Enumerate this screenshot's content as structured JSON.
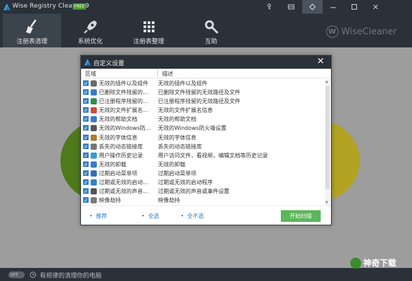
{
  "app": {
    "title": "Wise Registry Cleaner 9",
    "badge": "FREE",
    "brand": "WiseCleaner"
  },
  "nav": [
    {
      "label": "注册表清理",
      "icon": "broom-icon",
      "active": true
    },
    {
      "label": "系统优化",
      "icon": "rocket-icon",
      "active": false
    },
    {
      "label": "注册表整理",
      "icon": "blocks-icon",
      "active": false
    },
    {
      "label": "互助",
      "icon": "tools-icon",
      "active": false
    }
  ],
  "dialog": {
    "title": "自定义设置",
    "col_area": "区域",
    "col_desc": "描述",
    "rows": [
      {
        "name": "无效的插件以及组件",
        "desc": "无效的插件以及组件",
        "icon": "plugin-icon",
        "checked": true
      },
      {
        "name": "已删除文件残留的...",
        "desc": "已删除文件残留的无效路径及文件",
        "icon": "file-icon",
        "checked": true
      },
      {
        "name": "已注册程序残留的...",
        "desc": "已注册程序残留的无效路径及文件",
        "icon": "program-icon",
        "checked": true
      },
      {
        "name": "无效的文件扩展名...",
        "desc": "无效的文件扩展名信息",
        "icon": "extension-icon",
        "checked": true
      },
      {
        "name": "无效的帮助文档",
        "desc": "无效的帮助文档",
        "icon": "help-icon",
        "checked": true
      },
      {
        "name": "无效的Windows防...",
        "desc": "无效的Windows防火墙设置",
        "icon": "firewall-icon",
        "checked": true
      },
      {
        "name": "无效的字体信息",
        "desc": "无效的字体信息",
        "icon": "font-icon",
        "checked": true
      },
      {
        "name": "丢失的动态链接库",
        "desc": "丢失的动态链接库",
        "icon": "dll-icon",
        "checked": true
      },
      {
        "name": "用户操作历史记录",
        "desc": "用户访问文件，看视频，编辑文档等历史记录",
        "icon": "history-icon",
        "checked": true
      },
      {
        "name": "无效的卸载",
        "desc": "无效的卸载",
        "icon": "uninstall-icon",
        "checked": true
      },
      {
        "name": "过期启动菜单项",
        "desc": "过期启动菜单项",
        "icon": "startmenu-icon",
        "checked": true
      },
      {
        "name": "过期或无效的启动...",
        "desc": "过期或无效的启动程序",
        "icon": "startup-icon",
        "checked": true
      },
      {
        "name": "过期或无效的声音...",
        "desc": "过期或无效的声音或事件设置",
        "icon": "sound-icon",
        "checked": true
      },
      {
        "name": "映像劫持",
        "desc": "映像劫持",
        "icon": "image-icon",
        "checked": true
      }
    ],
    "footer": {
      "recommend": "推荐",
      "select_all": "全选",
      "select_none": "全不选",
      "scan": "开始扫描"
    }
  },
  "status": {
    "toggle": "OFF",
    "text": "有规律的清理你的电脑"
  },
  "watermark": "神奇下载",
  "colors": {
    "titlebar": "#2b3139",
    "checkbox": "#3b8bd1",
    "scan_button": "#5db65c",
    "link": "#2a7ac3"
  }
}
